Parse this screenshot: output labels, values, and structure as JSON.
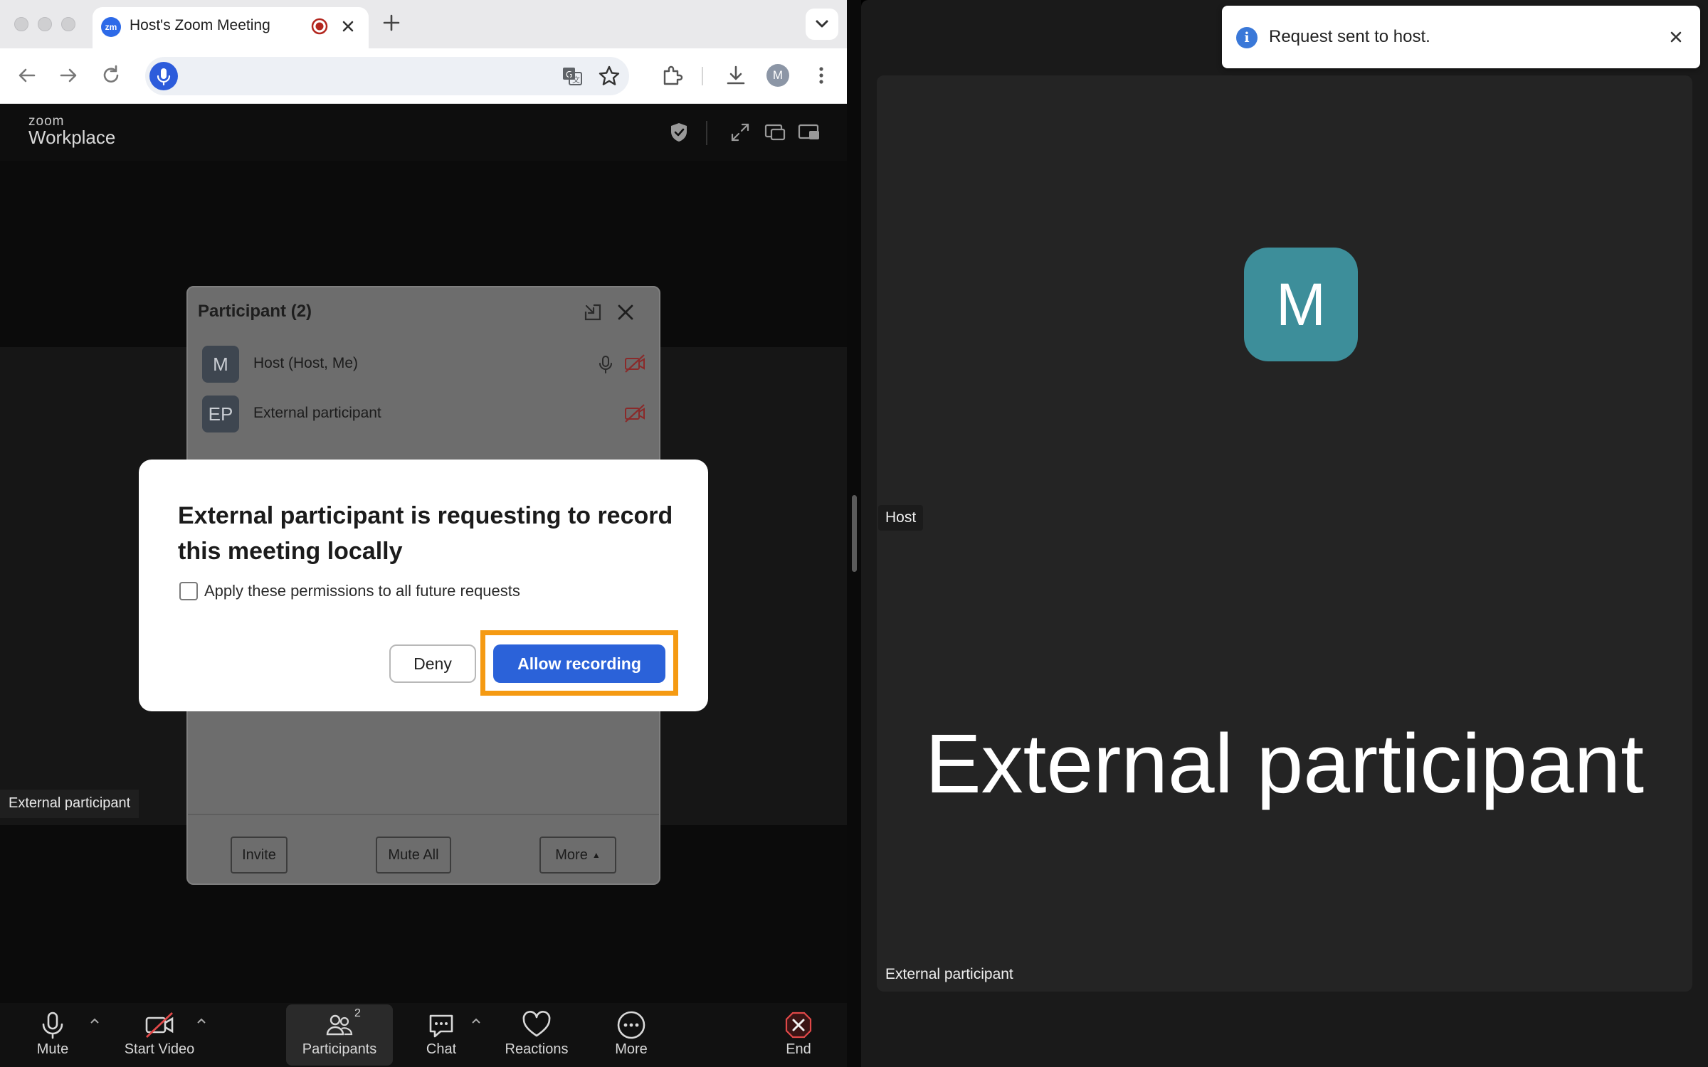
{
  "browser": {
    "tab": {
      "favicon_text": "zm",
      "title": "Host's Zoom Meeting"
    },
    "profile_initial": "M"
  },
  "zoom": {
    "logo_top": "zoom",
    "logo_bottom": "Workplace"
  },
  "participants_panel": {
    "title": "Participant (2)",
    "participants": [
      {
        "initials": "M",
        "name": "Host (Host, Me)"
      },
      {
        "initials": "EP",
        "name": "External participant"
      }
    ],
    "buttons": {
      "invite": "Invite",
      "mute_all": "Mute All",
      "more": "More"
    }
  },
  "modal": {
    "title": "External participant is requesting to record this meeting locally",
    "checkbox_label": "Apply these permissions to all future requests",
    "deny_label": "Deny",
    "allow_label": "Allow recording"
  },
  "left_stage": {
    "name_label": "External participant"
  },
  "bottom_bar": {
    "mute": "Mute",
    "start_video": "Start Video",
    "participants": "Participants",
    "participants_count": "2",
    "chat": "Chat",
    "reactions": "Reactions",
    "more": "More",
    "end": "End"
  },
  "right_window": {
    "avatar_initial": "M",
    "host_label": "Host",
    "big_name": "External participant",
    "name_label": "External participant",
    "toast": {
      "icon": "i",
      "text": "Request sent to host."
    }
  },
  "colors": {
    "accent_blue": "#2b62d9",
    "highlight_orange": "#f59a12",
    "avatar_teal": "#3d8e9a"
  }
}
